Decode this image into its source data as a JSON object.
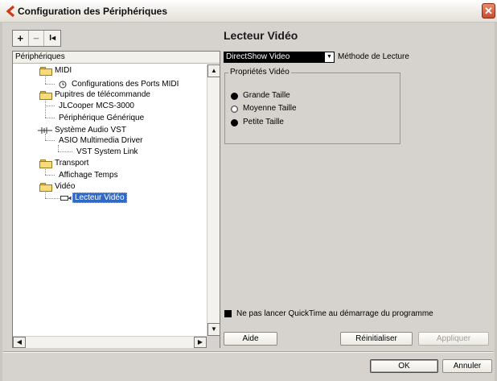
{
  "window": {
    "title": "Configuration des Périphériques",
    "close_glyph": "✕",
    "accent_color": "#cc3a1a"
  },
  "toolbar": {
    "add_label": "+",
    "remove_label": "−",
    "reset_label": "I◂"
  },
  "tree": {
    "header": "Périphériques",
    "items": [
      {
        "label": "MIDI",
        "icon": "folder-icon"
      },
      {
        "label": "Configurations des Ports MIDI",
        "icon": "clock-icon"
      },
      {
        "label": "Pupitres de télécommande",
        "icon": "folder-icon"
      },
      {
        "label": "JLCooper MCS-3000",
        "icon": ""
      },
      {
        "label": "Périphérique Générique",
        "icon": ""
      },
      {
        "label": "Système Audio VST",
        "icon": "audio-system-icon"
      },
      {
        "label": "ASIO Multimedia Driver",
        "icon": ""
      },
      {
        "label": "VST System Link",
        "icon": ""
      },
      {
        "label": "Transport",
        "icon": "folder-icon"
      },
      {
        "label": "Affichage Temps",
        "icon": ""
      },
      {
        "label": "Vidéo",
        "icon": "folder-icon"
      },
      {
        "label": "Lecteur Vidéo",
        "icon": "video-player-icon",
        "selected": true
      }
    ]
  },
  "panel": {
    "title": "Lecteur Vidéo",
    "method_value": "DirectShow Video",
    "method_label": "Méthode de Lecture",
    "group_title": "Propriétés Vidéo",
    "size_options": [
      {
        "label": "Grande Taille",
        "checked": true
      },
      {
        "label": "Moyenne Taille",
        "checked": false
      },
      {
        "label": "Petite Taille",
        "checked": true
      }
    ],
    "quicktime_label": "Ne pas lancer QuickTime au démarrage du programme"
  },
  "buttons": {
    "help": "Aide",
    "reset": "Réinitialiser",
    "apply": "Appliquer",
    "ok": "OK",
    "cancel": "Annuler"
  }
}
